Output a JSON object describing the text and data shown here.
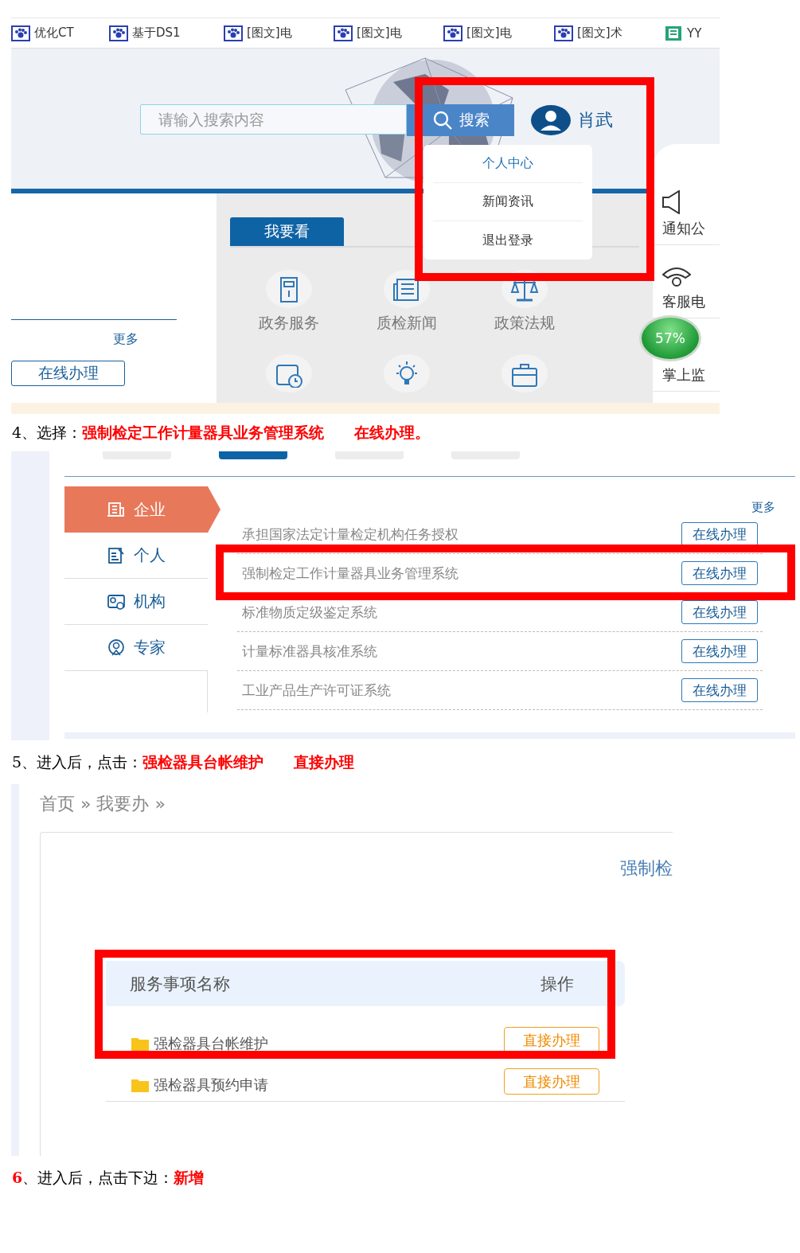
{
  "screenshot_1": {
    "highlight": true,
    "bookmarks": [
      {
        "label": "优化CT"
      },
      {
        "label": "基于DS1"
      },
      {
        "label": "[图文]电"
      },
      {
        "label": "[图文]电"
      },
      {
        "label": "[图文]电"
      },
      {
        "label": "[图文]术"
      },
      {
        "label": "YY"
      }
    ],
    "search": {
      "placeholder": "请输入搜索内容",
      "button": "搜索"
    },
    "user": {
      "name": "肖武"
    },
    "user_menu": [
      {
        "label": "个人中心",
        "selected": true
      },
      {
        "label": "新闻资讯",
        "selected": false
      },
      {
        "label": "退出登录",
        "selected": false
      }
    ],
    "left_panel": {
      "more": "更多",
      "button": "在线办理"
    },
    "tab": {
      "label": "我要看"
    },
    "services": [
      {
        "label": "政务服务"
      },
      {
        "label": "质检新闻"
      },
      {
        "label": "政策法规"
      }
    ],
    "side_links": [
      {
        "label": "通知公"
      },
      {
        "label": "客服电"
      },
      {
        "label": "掌上监"
      }
    ],
    "badge": {
      "label": "57%"
    }
  },
  "step_4": "4、选择：**强制检定工作计量器具业务管理系统**　　**在线办理。**",
  "screenshot_2": {
    "tabs": [
      {
        "selected": false
      },
      {
        "selected": true
      },
      {
        "selected": false
      },
      {
        "selected": false
      }
    ],
    "categories": [
      {
        "label": "企业",
        "selected": true
      },
      {
        "label": "个人",
        "selected": false
      },
      {
        "label": "机构",
        "selected": false
      },
      {
        "label": "专家",
        "selected": false
      }
    ],
    "more": "更多",
    "systems": [
      {
        "name": "承担国家法定计量检定机构任务授权",
        "button": "在线办理",
        "highlighted": false
      },
      {
        "name": "强制检定工作计量器具业务管理系统",
        "button": "在线办理",
        "highlighted": true
      },
      {
        "name": "标准物质定级鉴定系统",
        "button": "在线办理",
        "highlighted": false
      },
      {
        "name": "计量标准器具核准系统",
        "button": "在线办理",
        "highlighted": false
      },
      {
        "name": "工业产品生产许可证系统",
        "button": "在线办理",
        "highlighted": false
      }
    ]
  },
  "step_5": "5、进入后，点击：**强检器具台帐维护**　　**直接办理**",
  "screenshot_3": {
    "breadcrumb": "首页 » 我要办 »",
    "title": "强制检",
    "columns": [
      "服务事项名称",
      "操作"
    ],
    "rows": [
      {
        "name": "强检器具台帐维护",
        "action": "直接办理",
        "highlighted": true
      },
      {
        "name": "强检器具预约申请",
        "action": "直接办理",
        "highlighted": false
      }
    ]
  },
  "step_6": "**6**、进入后，点击下边：**新增**"
}
